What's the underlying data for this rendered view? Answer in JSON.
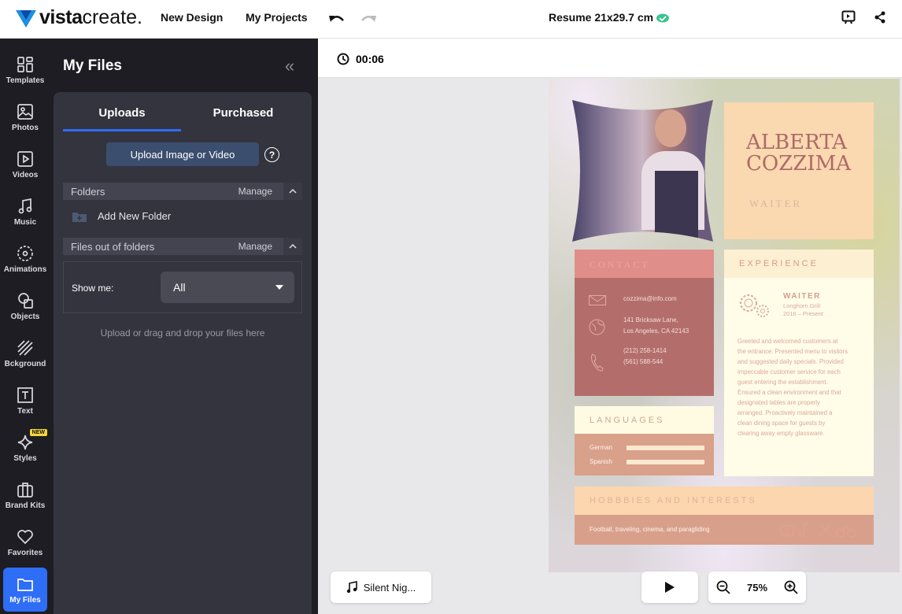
{
  "topbar": {
    "logo_bold": "vista",
    "logo_light": "create.",
    "nav": [
      "New Design",
      "My Projects"
    ],
    "document_title": "Resume 21x29.7 cm",
    "saved_status_color": "#3ec28f"
  },
  "rail": [
    {
      "label": "Templates",
      "icon": "templates-icon"
    },
    {
      "label": "Photos",
      "icon": "photos-icon"
    },
    {
      "label": "Videos",
      "icon": "videos-icon"
    },
    {
      "label": "Music",
      "icon": "music-icon"
    },
    {
      "label": "Animations",
      "icon": "animations-icon"
    },
    {
      "label": "Objects",
      "icon": "objects-icon"
    },
    {
      "label": "Bckground",
      "icon": "background-icon"
    },
    {
      "label": "Text",
      "icon": "text-icon"
    },
    {
      "label": "Styles",
      "icon": "styles-icon",
      "badge": "NEW"
    },
    {
      "label": "Brand Kits",
      "icon": "brand-kits-icon"
    },
    {
      "label": "Favorites",
      "icon": "favorites-icon"
    },
    {
      "label": "My Files",
      "icon": "folder-icon",
      "active": true
    }
  ],
  "panel": {
    "title": "My Files",
    "tabs": [
      "Uploads",
      "Purchased"
    ],
    "active_tab": "Uploads",
    "upload_button": "Upload Image or Video",
    "folders_label": "Folders",
    "manage": "Manage",
    "add_folder": "Add New Folder",
    "files_out_label": "Files out of folders",
    "show_me_label": "Show me:",
    "show_me_value": "All",
    "hint": "Upload or drag and drop your files here"
  },
  "timer": "00:06",
  "resume": {
    "name_line1": "ALBERTA",
    "name_line2": "COZZIMA",
    "role": "WAITER",
    "contact": {
      "heading": "CONTACT",
      "email": "cozzima@info.com",
      "address1": "141 Bricksaw Lane,",
      "address2": "Los Angeles, CA 42143",
      "phone1": "(212) 258-1414",
      "phone2": "(561) 588-544"
    },
    "experience": {
      "heading": "EXPERIENCE",
      "job": "WAITER",
      "company": "Longhorn Grill",
      "dates": "2016 – Present",
      "description": "Greeted and welcomed customers at the entrance. Presented menu to visitors and suggested daily specials. Provided impeccable customer service for each guest entering the establishment. Ensured a clean environment and that designated tables are properly arranged. Proactively maintained a clean dining space for guests by clearing away empty glassware."
    },
    "languages": {
      "heading": "LANGUAGES",
      "items": [
        {
          "name": "German",
          "level": 1.0
        },
        {
          "name": "Spanish",
          "level": 1.0
        }
      ]
    },
    "hobbies": {
      "heading": "HOBBBIES AND INTERESTS",
      "text": "Football, traveling, cinema, and paragliding"
    }
  },
  "bottom": {
    "music_track": "Silent Nig...",
    "zoom": "75%"
  }
}
